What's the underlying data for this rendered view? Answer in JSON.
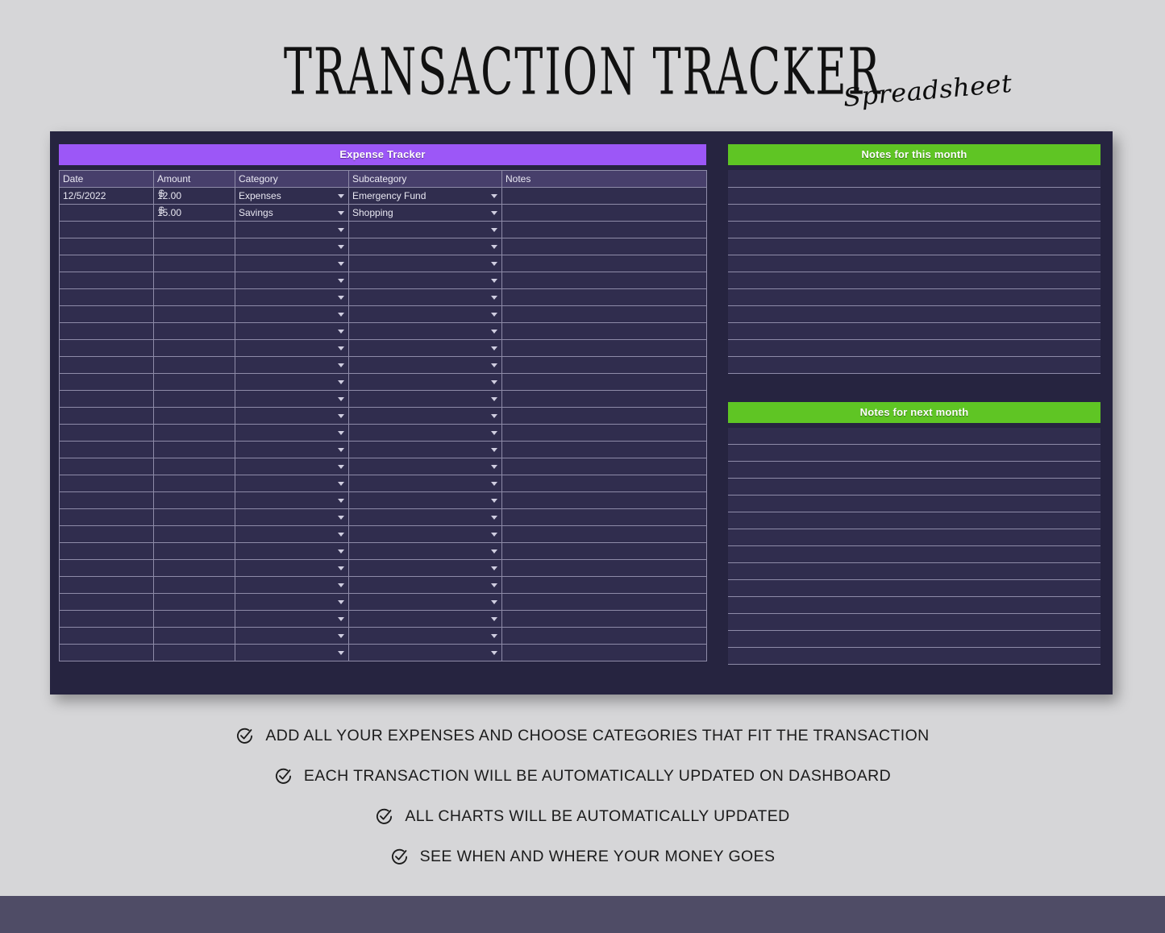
{
  "title": {
    "main": "TRANSACTION TRACKER",
    "script": "Spreadsheet"
  },
  "colors": {
    "page_background": "#d6d6d8",
    "panel_background": "#262440",
    "purple_header": "#9c57f7",
    "green_header": "#5fc524",
    "cell_background": "#302d4e",
    "header_row_background": "#473f6b",
    "grid_line": "#8e8ba8",
    "bottom_bar": "#4f4c66",
    "text_light": "#e9e8f2",
    "text_dark": "#1b1b1b"
  },
  "expense_tracker": {
    "header": "Expense Tracker",
    "columns": [
      "Date",
      "Amount",
      "Category",
      "Subcategory",
      "Notes"
    ],
    "rows": [
      {
        "date": "12/5/2022",
        "currency": "$",
        "amount": "12.00",
        "category": "Expenses",
        "subcategory": "Emergency Fund",
        "notes": ""
      },
      {
        "date": "",
        "currency": "$",
        "amount": "15.00",
        "category": "Savings",
        "subcategory": "Shopping",
        "notes": ""
      }
    ],
    "empty_row_count": 26,
    "total_row_count": 28
  },
  "notes_this_month": {
    "header": "Notes for this month",
    "row_count": 12,
    "rows": [
      "",
      "",
      "",
      "",
      "",
      "",
      "",
      "",
      "",
      "",
      "",
      ""
    ]
  },
  "notes_next_month": {
    "header": "Notes for next month",
    "row_count": 14,
    "rows": [
      "",
      "",
      "",
      "",
      "",
      "",
      "",
      "",
      "",
      "",
      "",
      "",
      "",
      ""
    ]
  },
  "features": [
    {
      "icon": "check-circle-icon",
      "text": "ADD ALL YOUR EXPENSES AND CHOOSE CATEGORIES THAT FIT THE TRANSACTION"
    },
    {
      "icon": "check-circle-icon",
      "text": "EACH TRANSACTION WILL BE AUTOMATICALLY UPDATED ON DASHBOARD"
    },
    {
      "icon": "check-circle-icon",
      "text": "ALL CHARTS WILL BE AUTOMATICALLY UPDATED"
    },
    {
      "icon": "check-circle-icon",
      "text": "SEE WHEN AND WHERE YOUR MONEY GOES"
    }
  ]
}
